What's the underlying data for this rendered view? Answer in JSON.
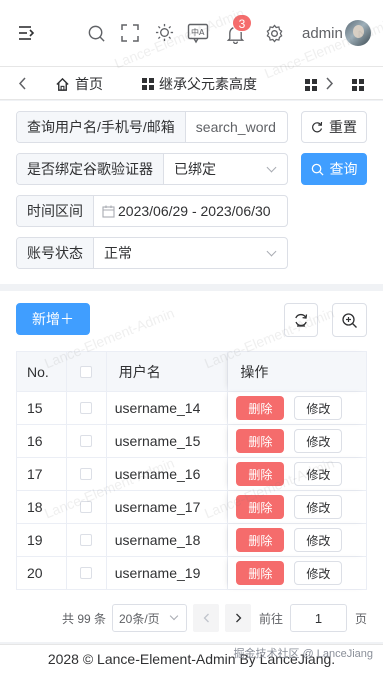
{
  "header": {
    "admin_name": "admin",
    "notification_count": "3",
    "icons": [
      "menu-fold-icon",
      "search-icon",
      "fullscreen-icon",
      "sun-icon",
      "translate-icon",
      "bell-icon",
      "gear-icon"
    ]
  },
  "tags": {
    "home_label": "首页",
    "tab_label": "继承父元素高度"
  },
  "search": {
    "keyword_label": "查询用户名/手机号/邮箱",
    "keyword_placeholder": "search_word",
    "reset_label": "重置",
    "google_label": "是否绑定谷歌验证器",
    "google_value": "已绑定",
    "query_label": "查询",
    "time_label": "时间区间",
    "time_value": "2023/06/29 - 2023/06/30",
    "status_label": "账号状态",
    "status_value": "正常"
  },
  "toolbar": {
    "add_label": "新增＋"
  },
  "table": {
    "columns": {
      "no": "No.",
      "username": "用户名",
      "actions": "操作"
    },
    "delete_label": "删除",
    "edit_label": "修改",
    "rows": [
      {
        "no": "15",
        "username": "username_14"
      },
      {
        "no": "16",
        "username": "username_15"
      },
      {
        "no": "17",
        "username": "username_16"
      },
      {
        "no": "18",
        "username": "username_17"
      },
      {
        "no": "19",
        "username": "username_18"
      },
      {
        "no": "20",
        "username": "username_19"
      }
    ]
  },
  "pagination": {
    "total": "共 99 条",
    "page_size": "20条/页",
    "goto_label": "前往",
    "current_page": "1",
    "page_suffix": "页"
  },
  "footer": {
    "copyright": "2028 © Lance-Element-Admin By LanceJiang.",
    "source_tag": "掘金技术社区 @ LanceJiang"
  },
  "watermark": "Lance-Element-Admin",
  "colors": {
    "primary": "#409eff",
    "danger": "#f56c6c",
    "background": "#f0f2f5"
  }
}
